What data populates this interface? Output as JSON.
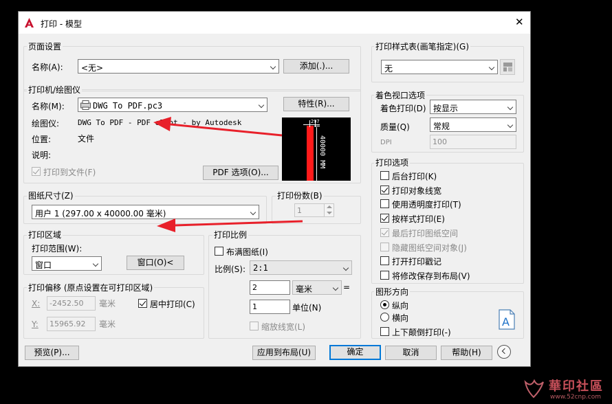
{
  "window": {
    "title": "打印 - 模型",
    "close_glyph": "✕"
  },
  "page_setup": {
    "group_label": "页面设置",
    "name_label": "名称(A):",
    "name_value": "<无>",
    "add_button": "添加(.)..."
  },
  "printer": {
    "group_label": "打印机/绘图仪",
    "name_label": "名称(M):",
    "name_value": "DWG To PDF.pc3",
    "properties_button": "特性(R)...",
    "plotter_label": "绘图仪:",
    "plotter_value": "DWG To PDF - PDF ePlot - by Autodesk",
    "location_label": "位置:",
    "location_value": "文件",
    "description_label": "说明:",
    "print_to_file_label": "打印到文件(F)",
    "pdf_options_button": "PDF 选项(O)...",
    "preview_dimension": "40000 MM",
    "preview_width_tick": "297"
  },
  "paper_size": {
    "group_label": "图纸尺寸(Z)",
    "value": "用户 1 (297.00 x 40000.00 毫米)"
  },
  "copies": {
    "group_label": "打印份数(B)",
    "value": "1"
  },
  "plot_area": {
    "group_label": "打印区域",
    "range_label": "打印范围(W):",
    "range_value": "窗口",
    "window_button": "窗口(O)<"
  },
  "plot_offset": {
    "group_label": "打印偏移 (原点设置在可打印区域)",
    "x_label": "X:",
    "x_value": "-2452.50",
    "x_unit": "毫米",
    "y_label": "Y:",
    "y_value": "15965.92",
    "y_unit": "毫米",
    "center_label": "居中打印(C)"
  },
  "plot_scale": {
    "group_label": "打印比例",
    "fit_label": "布满图纸(I)",
    "scale_label": "比例(S):",
    "scale_value": "2:1",
    "value1": "2",
    "unit_value": "毫米",
    "equals": "=",
    "value2": "1",
    "unit_label": "单位(N)",
    "lineweight_label": "缩放线宽(L)"
  },
  "plot_style_table": {
    "group_label": "打印样式表(画笔指定)(G)",
    "value": "无"
  },
  "shaded_viewport": {
    "group_label": "着色视口选项",
    "shade_label": "着色打印(D)",
    "shade_value": "按显示",
    "quality_label": "质量(Q)",
    "quality_value": "常规",
    "dpi_label": "DPI",
    "dpi_value": "100"
  },
  "plot_options": {
    "group_label": "打印选项",
    "items": [
      {
        "label": "后台打印(K)",
        "checked": false,
        "disabled": false
      },
      {
        "label": "打印对象线宽",
        "checked": true,
        "disabled": false
      },
      {
        "label": "使用透明度打印(T)",
        "checked": false,
        "disabled": false
      },
      {
        "label": "按样式打印(E)",
        "checked": true,
        "disabled": false
      },
      {
        "label": "最后打印图纸空间",
        "checked": true,
        "disabled": true
      },
      {
        "label": "隐藏图纸空间对象(J)",
        "checked": false,
        "disabled": true
      },
      {
        "label": "打开打印戳记",
        "checked": false,
        "disabled": false
      },
      {
        "label": "将修改保存到布局(V)",
        "checked": false,
        "disabled": false
      }
    ]
  },
  "orientation": {
    "group_label": "图形方向",
    "portrait_label": "纵向",
    "landscape_label": "横向",
    "upside_down_label": "上下颠倒打印(-)",
    "icon_letter": "A"
  },
  "footer": {
    "preview_button": "预览(P)...",
    "apply_button": "应用到布局(U)",
    "ok_button": "确定",
    "cancel_button": "取消",
    "help_button": "帮助(H)"
  },
  "watermark": {
    "brand": "華印社區",
    "url": "www.52cnp.com"
  },
  "colors": {
    "accent": "#0078d7",
    "annotation_arrow": "#e8202a",
    "app_icon": "#c8102e"
  }
}
